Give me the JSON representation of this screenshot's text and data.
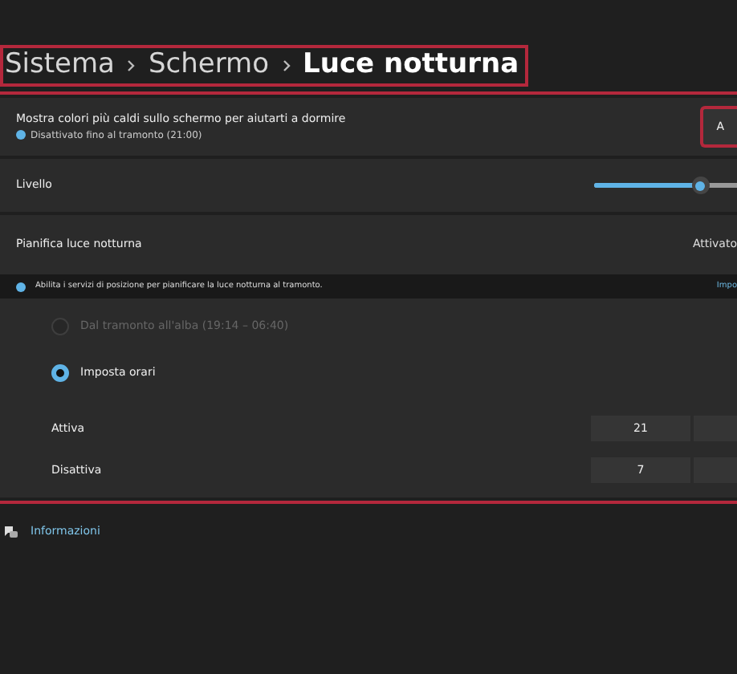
{
  "breadcrumb": [
    "Sistema",
    "Schermo",
    "Luce notturna"
  ],
  "night_light": {
    "title": "Mostra colori più caldi sullo schermo per aiutarti a dormire",
    "status": "Disattivato fino al tramonto (21:00)",
    "button": "A"
  },
  "strength": {
    "label": "Livello",
    "level": 0.74
  },
  "schedule": {
    "label": "Pianifica luce notturna",
    "state": "Attivato"
  },
  "location_notice": {
    "text": "Abilita i servizi di posizione per pianificare la luce notturna al tramonto.",
    "link": "Impo"
  },
  "schedule_options": [
    {
      "label": "Dal tramonto all'alba (19:14 – 06:40)",
      "selected": false,
      "disabled": true
    },
    {
      "label": "Imposta orari",
      "selected": true,
      "disabled": false
    }
  ],
  "times": [
    {
      "label": "Attiva",
      "hour": "21"
    },
    {
      "label": "Disattiva",
      "hour": "7"
    }
  ],
  "help_link": "Informazioni"
}
